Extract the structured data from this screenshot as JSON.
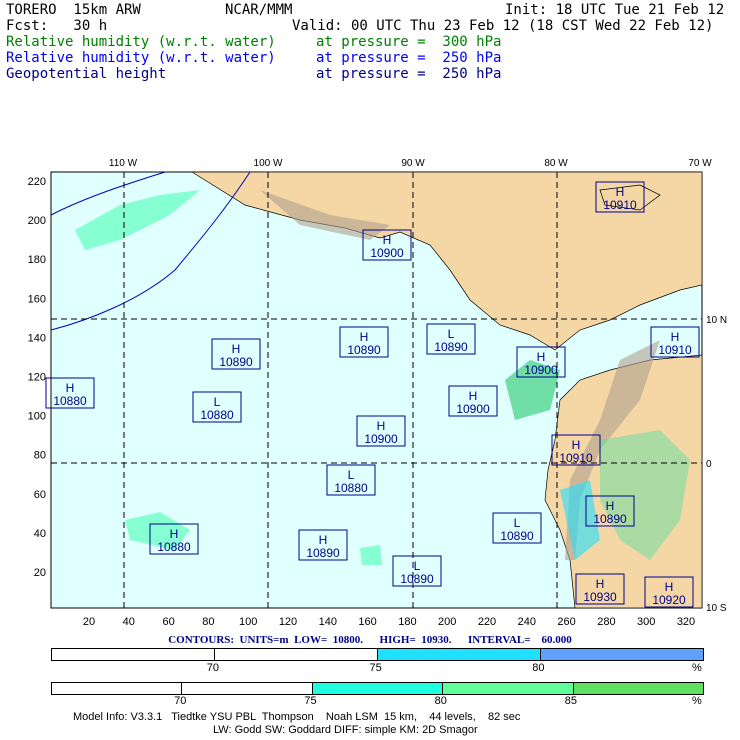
{
  "header": {
    "model": "TORERO  15km ARW",
    "org": "NCAR/MMM",
    "init": "Init: 18 UTC Tue 21 Feb 12",
    "fcst": "Fcst:   30 h",
    "valid": "Valid: 00 UTC Thu 23 Feb 12 (18 CST Wed 22 Feb 12)"
  },
  "fields": [
    {
      "name": "Relative humidity (w.r.t. water)",
      "level": "at pressure =  300 hPa",
      "color": "#008000"
    },
    {
      "name": "Relative humidity (w.r.t. water)",
      "level": "at pressure =  250 hPa",
      "color": "#0000ff"
    },
    {
      "name": "Geopotential height",
      "level": "at pressure =  250 hPa",
      "color": "#00008b"
    }
  ],
  "axes": {
    "top": [
      "110 W",
      "100 W",
      "90 W",
      "80 W",
      "70 W"
    ],
    "right": [
      "10 N",
      "0",
      "10 S"
    ],
    "left": [
      "220",
      "200",
      "180",
      "160",
      "140",
      "120",
      "100",
      "80",
      "60",
      "40",
      "20"
    ],
    "bottom": [
      "20",
      "40",
      "60",
      "80",
      "100",
      "120",
      "140",
      "160",
      "180",
      "200",
      "220",
      "240",
      "260",
      "280",
      "300",
      "320"
    ]
  },
  "centers": [
    {
      "t": "H",
      "v": "10910"
    },
    {
      "t": "H",
      "v": "10900"
    },
    {
      "t": "H",
      "v": "10890"
    },
    {
      "t": "H",
      "v": "10890"
    },
    {
      "t": "L",
      "v": "10890"
    },
    {
      "t": "H",
      "v": "10910"
    },
    {
      "t": "H",
      "v": "10900"
    },
    {
      "t": "H",
      "v": "10880"
    },
    {
      "t": "L",
      "v": "10880"
    },
    {
      "t": "H",
      "v": "10900"
    },
    {
      "t": "H",
      "v": "10900"
    },
    {
      "t": "L",
      "v": "10880"
    },
    {
      "t": "H",
      "v": "10910"
    },
    {
      "t": "H",
      "v": "10890"
    },
    {
      "t": "L",
      "v": "10890"
    },
    {
      "t": "H",
      "v": "10880"
    },
    {
      "t": "H",
      "v": "10890"
    },
    {
      "t": "L",
      "v": "10890"
    },
    {
      "t": "H",
      "v": "10930"
    },
    {
      "t": "H",
      "v": "10920"
    }
  ],
  "contours": "CONTOURS:  UNITS=m  LOW=  10800.      HIGH=  10930.      INTERVAL=    60.000",
  "legend1": {
    "labels": [
      "70",
      "75",
      "80",
      "%"
    ],
    "colors": [
      "#ffffff",
      "#ffffff",
      "#20e0ff",
      "#60a0ff"
    ]
  },
  "legend2": {
    "labels": [
      "70",
      "75",
      "80",
      "85",
      "%"
    ],
    "colors": [
      "#ffffff",
      "#ffffff",
      "#20ffe0",
      "#60ff9a",
      "#60e060"
    ]
  },
  "footer": [
    "Model Info: V3.3.1   Tiedtke YSU PBL  Thompson    Noah LSM  15 km,    44 levels,    82 sec",
    "LW: Godd SW: Goddard DIFF: simple KM: 2D Smagor"
  ]
}
